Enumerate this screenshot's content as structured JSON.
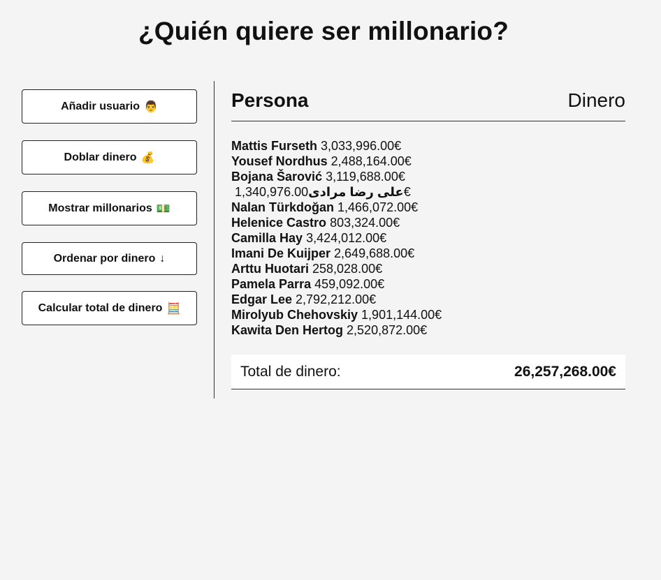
{
  "title": "¿Quién quiere ser millonario?",
  "sidebar": {
    "buttons": [
      {
        "label": "Añadir usuario",
        "icon": "👨",
        "icon_name": "person-icon"
      },
      {
        "label": "Doblar dinero",
        "icon": "💰",
        "icon_name": "money-bag-icon"
      },
      {
        "label": "Mostrar millonarios",
        "icon": "💵",
        "icon_name": "banknote-icon"
      },
      {
        "label": "Ordenar por dinero",
        "icon": "↓",
        "icon_name": "arrow-down-icon"
      },
      {
        "label": "Calcular total de dinero",
        "icon": "🧮",
        "icon_name": "abacus-icon"
      }
    ]
  },
  "main": {
    "header": {
      "person": "Persona",
      "money": "Dinero"
    },
    "rows": [
      {
        "name": "Mattis Furseth",
        "amount": "3,033,996.00€"
      },
      {
        "name": "Yousef Nordhus",
        "amount": "2,488,164.00€"
      },
      {
        "name": "Bojana Šarović",
        "amount": "3,119,688.00€"
      },
      {
        "name": "علی رضا مرادی",
        "amount": "1,340,976.00€"
      },
      {
        "name": "Nalan Türkdoğan",
        "amount": "1,466,072.00€"
      },
      {
        "name": "Helenice Castro",
        "amount": "803,324.00€"
      },
      {
        "name": "Camilla Hay",
        "amount": "3,424,012.00€"
      },
      {
        "name": "Imani De Kuijper",
        "amount": "2,649,688.00€"
      },
      {
        "name": "Arttu Huotari",
        "amount": "258,028.00€"
      },
      {
        "name": "Pamela Parra",
        "amount": "459,092.00€"
      },
      {
        "name": "Edgar Lee",
        "amount": "2,792,212.00€"
      },
      {
        "name": "Mirolyub Chehovskiy",
        "amount": "1,901,144.00€"
      },
      {
        "name": "Kawita Den Hertog",
        "amount": "2,520,872.00€"
      }
    ],
    "total": {
      "label": "Total de dinero:",
      "value": "26,257,268.00€"
    }
  }
}
